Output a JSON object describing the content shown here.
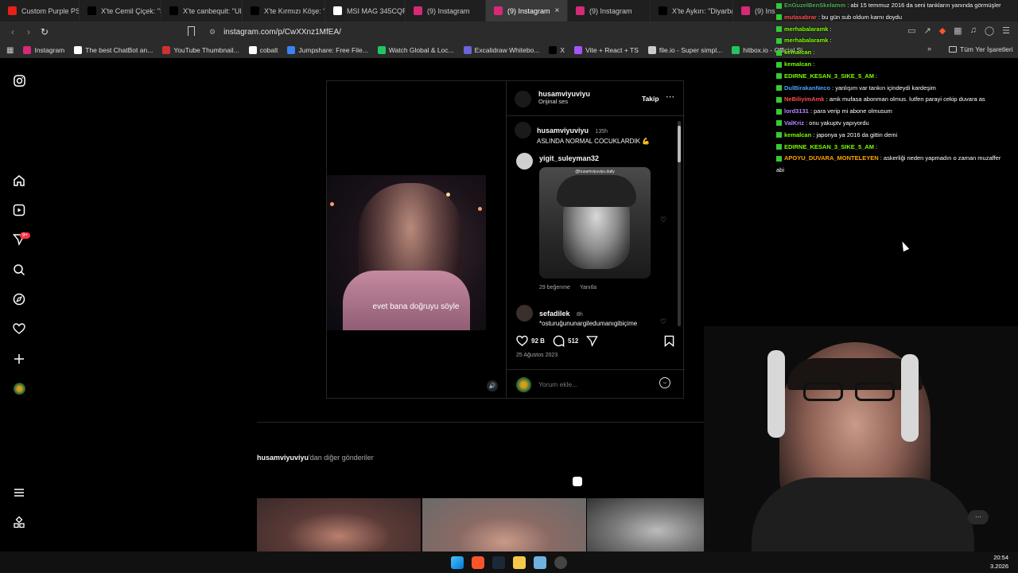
{
  "tabs": [
    {
      "label": "Custom Purple PSP",
      "color": "#e62117",
      "active": false
    },
    {
      "label": "X'te Cemil Çiçek: \"Ş",
      "color": "#000000",
      "active": false
    },
    {
      "label": "X'te canbequit: \"Ula",
      "color": "#000000",
      "active": false
    },
    {
      "label": "X'te Kırmızı Köşe: \"A",
      "color": "#000000",
      "active": false
    },
    {
      "label": "MSI MAG 345CQR 3",
      "color": "#ffffff",
      "active": false
    },
    {
      "label": "(9) Instagram",
      "color": "#d62976",
      "active": false
    },
    {
      "label": "(9) Instagram",
      "color": "#d62976",
      "active": true
    },
    {
      "label": "(9) Instagram",
      "color": "#d62976",
      "active": false
    },
    {
      "label": "X'te Aykırı: \"Diyarba",
      "color": "#000000",
      "active": false
    },
    {
      "label": "(9) Ins",
      "color": "#d62976",
      "active": false
    }
  ],
  "address": {
    "url": "instagram.com/p/CwXXnz1MfEA/"
  },
  "bookmarks": [
    {
      "label": "Instagram",
      "color": "#d62976"
    },
    {
      "label": "The best ChatBot an...",
      "color": "#ffffff"
    },
    {
      "label": "YouTube Thumbnail...",
      "color": "#cc3333"
    },
    {
      "label": "cobalt",
      "color": "#ffffff"
    },
    {
      "label": "Jumpshare: Free File...",
      "color": "#3b82f6"
    },
    {
      "label": "Watch Global & Loc...",
      "color": "#22c55e"
    },
    {
      "label": "Excalidraw Whitebo...",
      "color": "#6965db"
    },
    {
      "label": "X",
      "color": "#000000"
    },
    {
      "label": "Vite + React + TS",
      "color": "#a855f7"
    },
    {
      "label": "file.io - Super simpl...",
      "color": "#cccccc"
    },
    {
      "label": "hitbox.io - Official Si...",
      "color": "#22c55e"
    }
  ],
  "bookmarks_all": "Tüm Yer İşaretleri",
  "post": {
    "username": "husamviyuviyu",
    "audio": "Orijinal ses",
    "follow": "Takip",
    "subtitle": "evet bana doğruyu söyle",
    "caption_user": "husamviyuviyu",
    "caption_time": "135h",
    "caption_text": "ASLINDA NORMAL COCUKLARDIK",
    "comment1_user": "yigit_suleyman32",
    "gif_watermark": "@husamviyuviyu.daily",
    "comment1_likes": "29 beğenme",
    "comment1_reply": "Yanıtla",
    "comment2_user": "sefadilek",
    "comment2_time": "8h",
    "comment2_text": "*osturuğununargiledumanıgibiçime",
    "likes": "92 B",
    "comment_count": "512",
    "date": "25 Ağustos 2023",
    "add_comment_placeholder": "Yorum ekle..."
  },
  "more_posts": {
    "user": "husamviyuviyu",
    "suffix": "'dan diğer gönderiler"
  },
  "chat": [
    {
      "user": "EnGuzelBenSkelamm",
      "color": "#4caf50",
      "text": " : abi 15 temmuz 2016 da seni tankların yanında görmüşler"
    },
    {
      "user": "mutasabrar",
      "color": "#ff4d4d",
      "text": " : bu gün sub oldum karnı doydu"
    },
    {
      "user": "merhabalaramk",
      "color": "#7CFC00",
      "text": " : "
    },
    {
      "user": "merhabalaramk",
      "color": "#7CFC00",
      "text": " : "
    },
    {
      "user": "kemalcan",
      "color": "#7CFC00",
      "text": " : "
    },
    {
      "user": "kemalcan",
      "color": "#7CFC00",
      "text": " : "
    },
    {
      "user": "EDIRNE_KESAN_3_SIKE_5_AM",
      "color": "#7CFC00",
      "text": " : "
    },
    {
      "user": "DulBirakanNeco",
      "color": "#4aa3ff",
      "text": " : yanlışım var tankın içindeydi kardeşim"
    },
    {
      "user": "NeBiliyimAmk",
      "color": "#ff4d4d",
      "text": " : amk mufasa abonman olmus. lutfen parayi cekip duvara as"
    },
    {
      "user": "lord3131",
      "color": "#b388ff",
      "text": " : para verip mi abone olmusum"
    },
    {
      "user": "ValKriz",
      "color": "#b388ff",
      "text": " : onu yakuptv yapıyordu"
    },
    {
      "user": "kemalcan",
      "color": "#7CFC00",
      "text": " : japonya ya 2016 da gittin demi"
    },
    {
      "user": "EDIRNE_KESAN_3_SIKE_5_AM",
      "color": "#7CFC00",
      "text": " : "
    },
    {
      "user": "APOYU_DUVARA_MONTELEYEN",
      "color": "#ffa500",
      "text": " : askerliği neden yapmadın o zaman muzaffer"
    },
    {
      "user": "",
      "color": "#ffffff",
      "text": "abi"
    }
  ],
  "rail_badge": "9+",
  "clock": {
    "time": "20:54",
    "date": "3.2026"
  }
}
